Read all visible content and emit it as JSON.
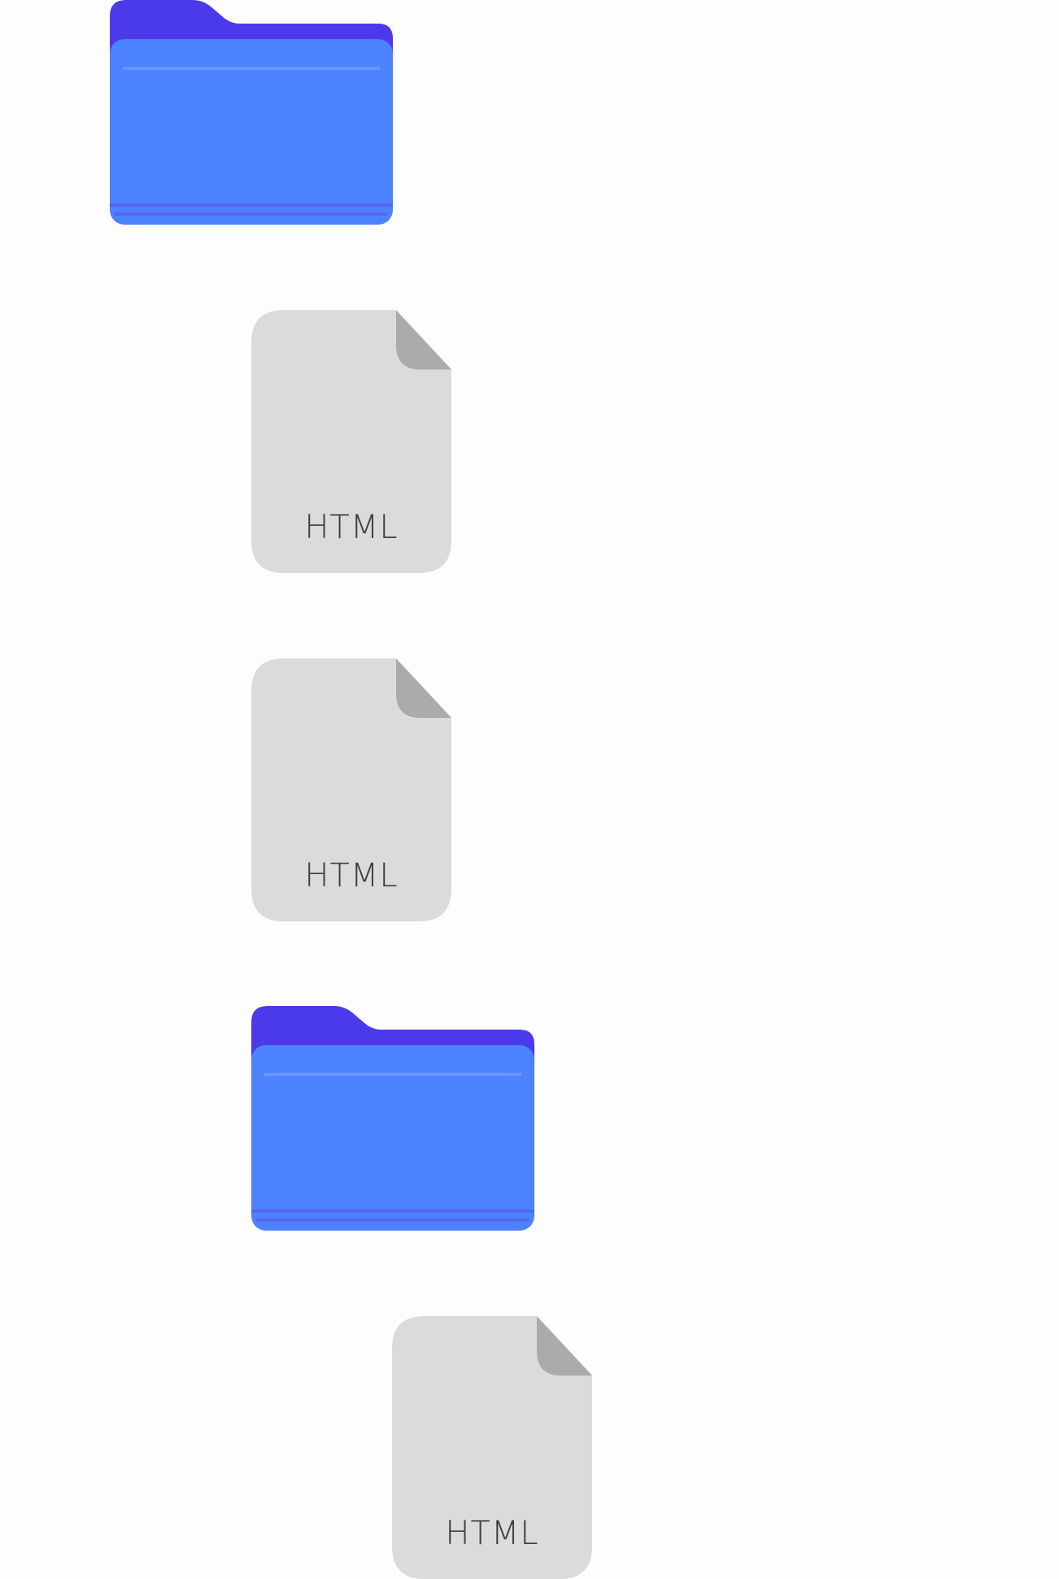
{
  "colors": {
    "background": "#fdfdfd",
    "folder_back": "#4a3aea",
    "folder_front": "#4d82ff",
    "folder_line": "#5465f0",
    "folder_highlight": "#6a95ff",
    "file_body": "#dbdbde",
    "file_fold": "#ababad",
    "file_text": "#3d3d3f"
  },
  "items": [
    {
      "type": "folder",
      "icon": "folder-icon"
    },
    {
      "type": "file",
      "icon": "html-file-icon",
      "label": "HTML"
    },
    {
      "type": "file",
      "icon": "html-file-icon",
      "label": "HTML"
    },
    {
      "type": "folder",
      "icon": "folder-icon"
    },
    {
      "type": "file",
      "icon": "html-file-icon",
      "label": "HTML"
    }
  ]
}
